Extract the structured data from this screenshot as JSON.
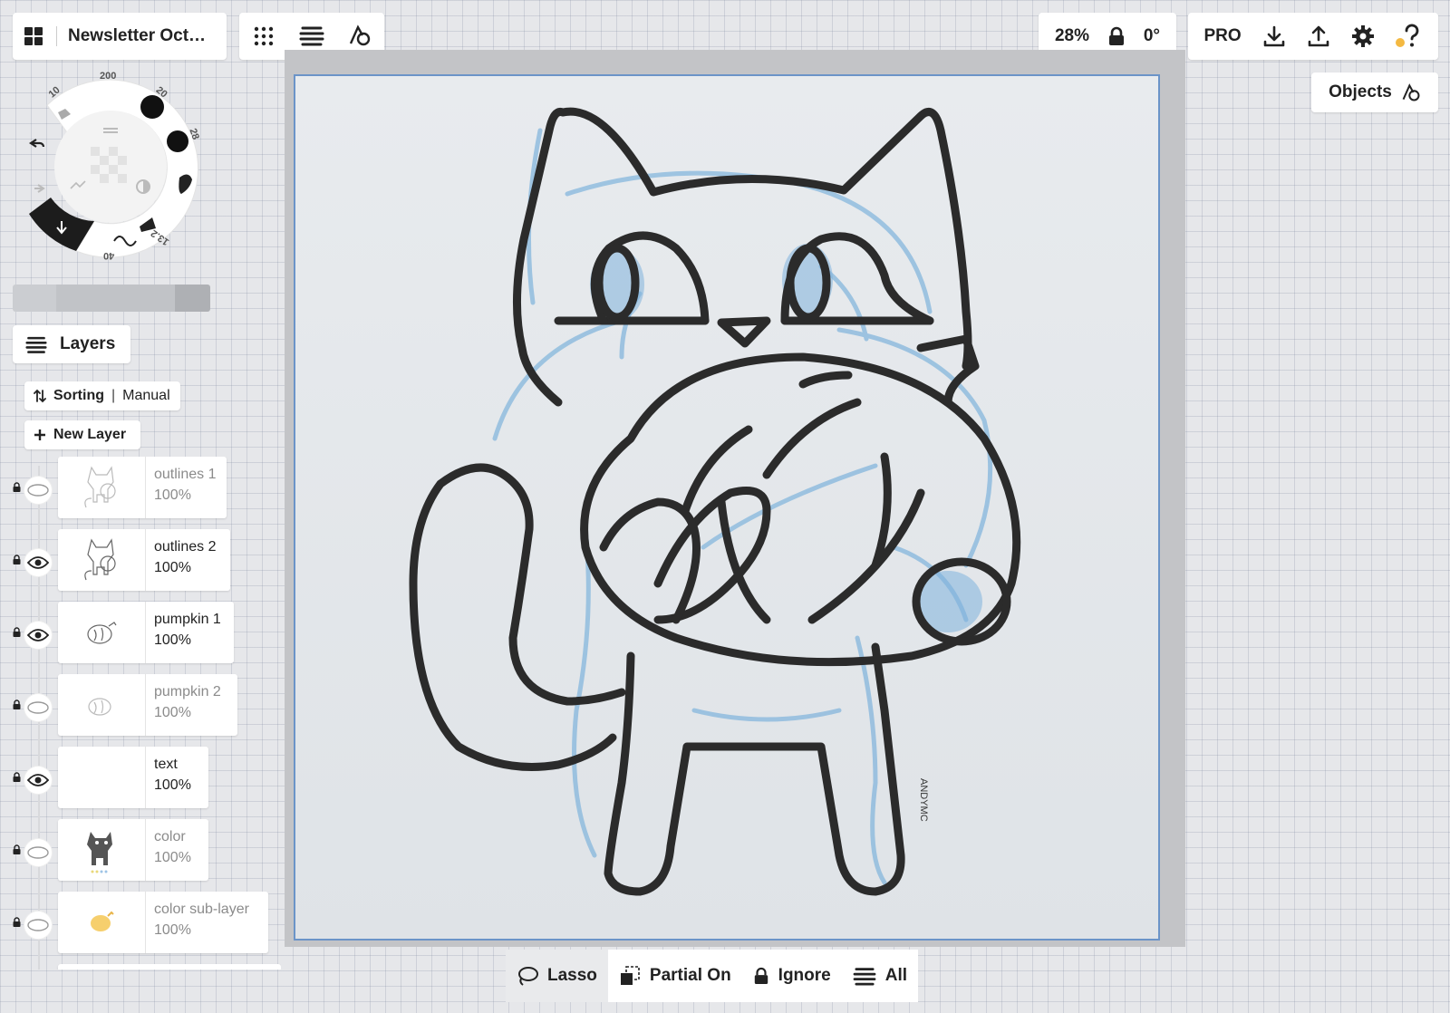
{
  "document": {
    "title": "Newsletter Oct…"
  },
  "view": {
    "zoom": "28%",
    "rotation": "0°"
  },
  "top_actions": {
    "pro_label": "PRO"
  },
  "objects_panel": {
    "label": "Objects"
  },
  "tool_wheel": {
    "size_labels": [
      "10",
      "200",
      "20",
      "28",
      "13.2",
      "40"
    ]
  },
  "layers": {
    "header": "Layers",
    "sorting_label": "Sorting",
    "sorting_mode": "Manual",
    "new_layer_label": "New Layer",
    "items": [
      {
        "name": "outlines 1",
        "opacity": "100%",
        "visible": false
      },
      {
        "name": "outlines 2",
        "opacity": "100%",
        "visible": true
      },
      {
        "name": "pumpkin 1",
        "opacity": "100%",
        "visible": true
      },
      {
        "name": "pumpkin 2",
        "opacity": "100%",
        "visible": false
      },
      {
        "name": "text",
        "opacity": "100%",
        "visible": true
      },
      {
        "name": "color",
        "opacity": "100%",
        "visible": false
      },
      {
        "name": "color sub-layer",
        "opacity": "100%",
        "visible": false
      }
    ]
  },
  "canvas": {
    "signature": "ANDYMC"
  },
  "selection_toolbar": {
    "lasso": "Lasso",
    "partial": "Partial On",
    "ignore": "Ignore",
    "all": "All"
  },
  "colors": {
    "sketch_blue": "#7fb3dc",
    "outline": "#2b2b2b",
    "canvas_border": "#6b94c8",
    "help_dot": "#f4b942"
  }
}
